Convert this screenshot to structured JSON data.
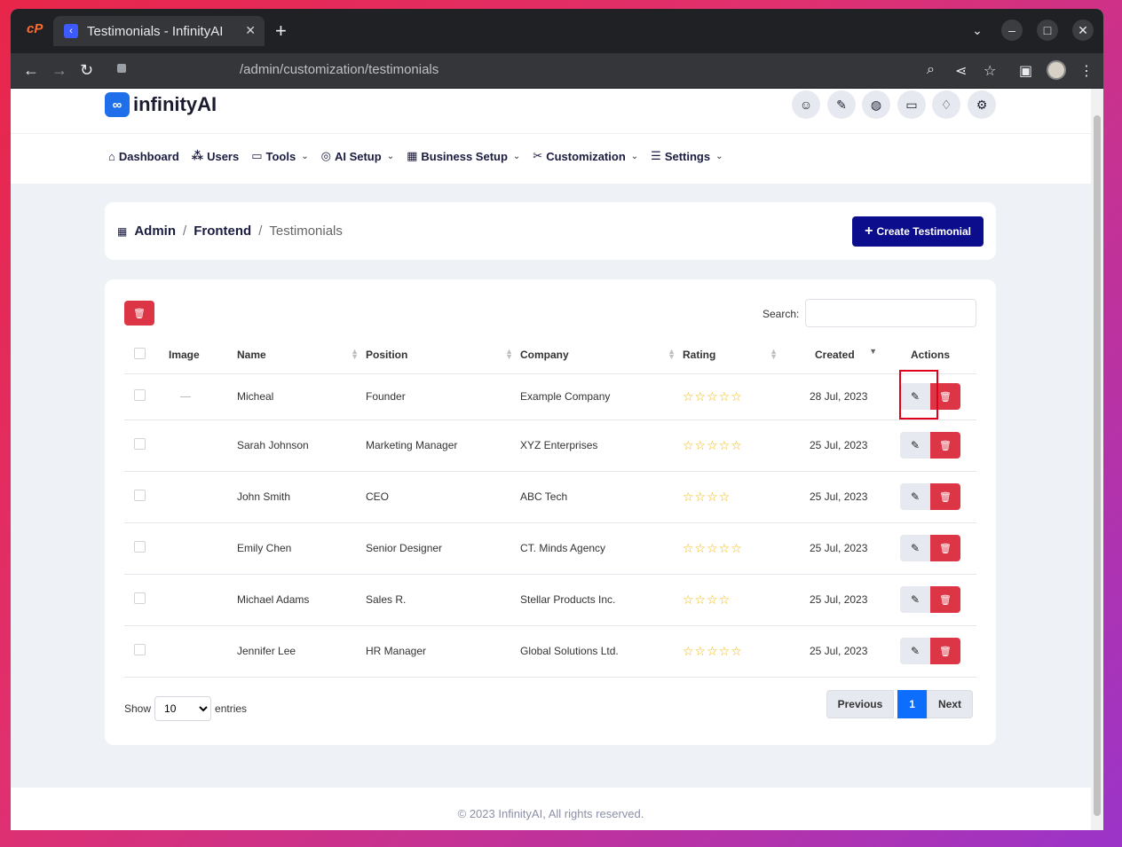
{
  "browser": {
    "tab_title": "Testimonials - InfinityAI",
    "url": "/admin/customization/testimonials"
  },
  "brand": {
    "logo_text": "infinityAI",
    "mark": "∞"
  },
  "nav": [
    {
      "label": "Dashboard",
      "icon": "home-icon"
    },
    {
      "label": "Users",
      "icon": "users-icon"
    },
    {
      "label": "Tools",
      "icon": "briefcase-icon"
    },
    {
      "label": "AI Setup",
      "icon": "ai-icon"
    },
    {
      "label": "Business Setup",
      "icon": "building-icon"
    },
    {
      "label": "Customization",
      "icon": "tools-icon"
    },
    {
      "label": "Settings",
      "icon": "sliders-icon"
    }
  ],
  "breadcrumb": {
    "root": "Admin",
    "parent": "Frontend",
    "current": "Testimonials"
  },
  "create_button": "Create Testimonial",
  "search_label": "Search:",
  "table": {
    "headers": [
      "Image",
      "Name",
      "Position",
      "Company",
      "Rating",
      "Created",
      "Actions"
    ],
    "rows": [
      {
        "name": "Micheal",
        "position": "Founder",
        "company": "Example Company",
        "rating": 5,
        "created": "28 Jul, 2023"
      },
      {
        "name": "Sarah Johnson",
        "position": "Marketing Manager",
        "company": "XYZ Enterprises",
        "rating": 5,
        "created": "25 Jul, 2023"
      },
      {
        "name": "John Smith",
        "position": "CEO",
        "company": "ABC Tech",
        "rating": 4,
        "created": "25 Jul, 2023"
      },
      {
        "name": "Emily Chen",
        "position": "Senior Designer",
        "company": "CT. Minds Agency",
        "rating": 5,
        "created": "25 Jul, 2023"
      },
      {
        "name": "Michael Adams",
        "position": "Sales R.",
        "company": "Stellar Products Inc.",
        "rating": 4,
        "created": "25 Jul, 2023"
      },
      {
        "name": "Jennifer Lee",
        "position": "HR Manager",
        "company": "Global Solutions Ltd.",
        "rating": 5,
        "created": "25 Jul, 2023"
      }
    ]
  },
  "entries": {
    "show": "Show",
    "value": "10",
    "suffix": "entries"
  },
  "pager": {
    "previous": "Previous",
    "page": "1",
    "next": "Next"
  },
  "footer": "© 2023 InfinityAI, All rights reserved.",
  "colors": {
    "primary": "#0c0d8c",
    "danger": "#dc3545",
    "star": "#f2b705",
    "active_page": "#0d6efd"
  }
}
